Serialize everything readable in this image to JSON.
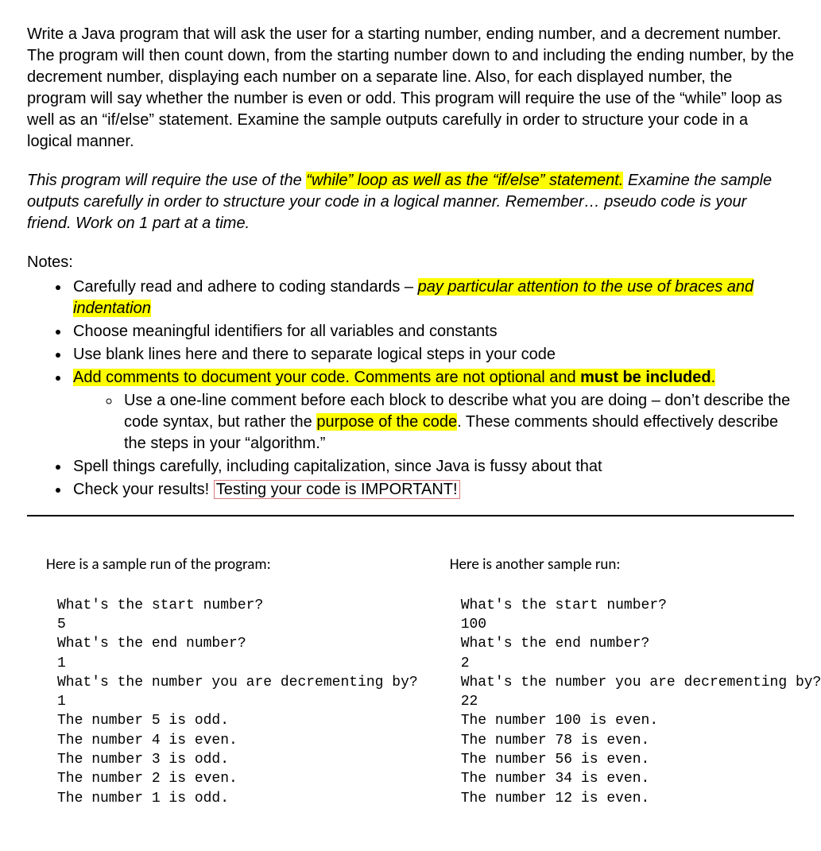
{
  "intro": "Write a Java program that will ask the user for a starting number, ending number, and a decrement number.  The program will then count down, from the starting number down to and including the ending number, by the decrement number, displaying each number on a separate line. Also, for each displayed number, the program will say whether the number is even or odd. This program will require the use of the “while” loop as well as an “if/else” statement. Examine the sample outputs carefully in order to structure your code in a logical manner.",
  "italic_pre": "This program will require the use of the ",
  "italic_hl": "“while” loop as well as the “if/else” statement.",
  "italic_post": " Examine the sample outputs carefully in order to structure your code in a logical manner. Remember… pseudo code is your friend. Work on 1 part at a time.",
  "notes_title": "Notes:",
  "note1_a": "Carefully read and adhere to coding standards – ",
  "note1_b": "pay particular attention to the use of braces and indentation",
  "note2": "Choose meaningful identifiers for all variables and constants",
  "note3": "Use blank lines here and there to separate logical steps in your code",
  "note4_a": "Add comments to document your code. Comments are not optional and ",
  "note4_b": "must be included",
  "note4_c": ".",
  "sub1_a": "Use a one-line comment before each block to describe what you are doing – don’t describe the code syntax, but rather the ",
  "sub1_b": "purpose of the code",
  "sub1_c": ". These comments should effectively describe the steps in your “algorithm.”",
  "note5": "Spell things carefully, including capitalization, since Java is fussy about that",
  "note6_a": "Check your results! ",
  "note6_b": "Testing your code is IMPORTANT!",
  "sample1_title": "Here is a sample run of the program:",
  "sample2_title": "Here is another sample run:",
  "sample1_code": "What's the start number?\n5\nWhat's the end number?\n1\nWhat's the number you are decrementing by?\n1\nThe number 5 is odd.\nThe number 4 is even.\nThe number 3 is odd.\nThe number 2 is even.\nThe number 1 is odd.",
  "sample2_code": "What's the start number?\n100\nWhat's the end number?\n2\nWhat's the number you are decrementing by?\n22\nThe number 100 is even.\nThe number 78 is even.\nThe number 56 is even.\nThe number 34 is even.\nThe number 12 is even."
}
